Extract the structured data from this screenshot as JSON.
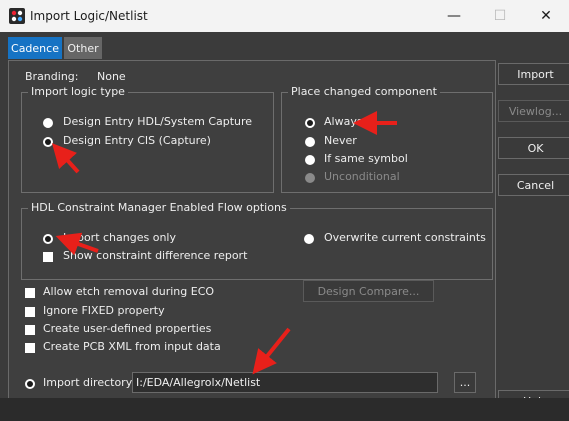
{
  "window": {
    "title": "Import Logic/Netlist",
    "minimize_glyph": "—",
    "maximize_glyph": "☐",
    "close_glyph": "✕"
  },
  "tabs": [
    {
      "label": "Cadence",
      "active": true
    },
    {
      "label": "Other",
      "active": false
    }
  ],
  "branding": {
    "label": "Branding:",
    "value": "None"
  },
  "import_logic_type": {
    "legend": "Import logic type",
    "options": [
      {
        "label": "Design Entry HDL/System Capture",
        "selected": false
      },
      {
        "label": "Design Entry CIS (Capture)",
        "selected": true
      }
    ]
  },
  "place_changed": {
    "legend": "Place changed component",
    "options": [
      {
        "label": "Always",
        "selected": true
      },
      {
        "label": "Never",
        "selected": false
      },
      {
        "label": "If same symbol",
        "selected": false
      },
      {
        "label": "Unconditional",
        "selected": false,
        "disabled": true
      }
    ]
  },
  "hdl_flow": {
    "legend": "HDL Constraint Manager Enabled Flow options",
    "import_changes_only": "Import changes only",
    "overwrite": "Overwrite current constraints",
    "show_report": "Show constraint difference report"
  },
  "checkboxes": [
    {
      "label": "Allow etch removal during ECO"
    },
    {
      "label": "Ignore FIXED property"
    },
    {
      "label": "Create user-defined properties"
    },
    {
      "label": "Create PCB XML from input data"
    }
  ],
  "design_compare": "Design Compare...",
  "import_directory": {
    "label": "Import directory:",
    "value": "I:/EDA/Allegrolx/Netlist",
    "browse": "..."
  },
  "side_buttons": [
    {
      "label": "Import",
      "disabled": false
    },
    {
      "label": "Viewlog...",
      "disabled": true
    },
    {
      "label": "OK",
      "disabled": false
    },
    {
      "label": "Cancel",
      "disabled": false
    },
    {
      "label": "Help",
      "disabled": false
    }
  ],
  "colors": {
    "accent_tab": "#1673c4",
    "annotation_arrow": "#e8201a",
    "dialog_bg": "#3b3b3b",
    "titlebar_bg": "#f3f3f3"
  }
}
